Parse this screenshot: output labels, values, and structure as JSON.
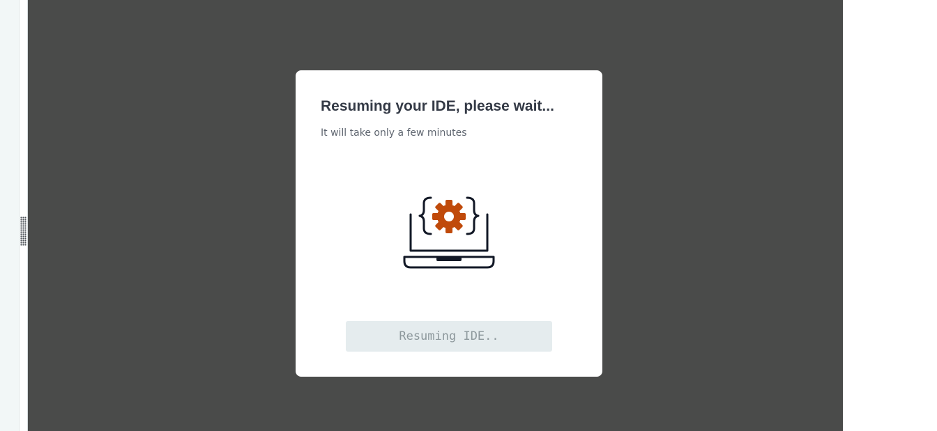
{
  "modal": {
    "title": "Resuming your IDE, please wait...",
    "subtitle": "It will take only a few minutes",
    "illustration_icon": "laptop-code-gear-icon",
    "button_label": "Resuming IDE..",
    "button_disabled": true
  },
  "colors": {
    "overlay": "#4a4b4a",
    "gear_accent": "#c04a0a",
    "line_art": "#121826",
    "button_bg": "#e5ecee",
    "button_text": "#8d989c"
  }
}
